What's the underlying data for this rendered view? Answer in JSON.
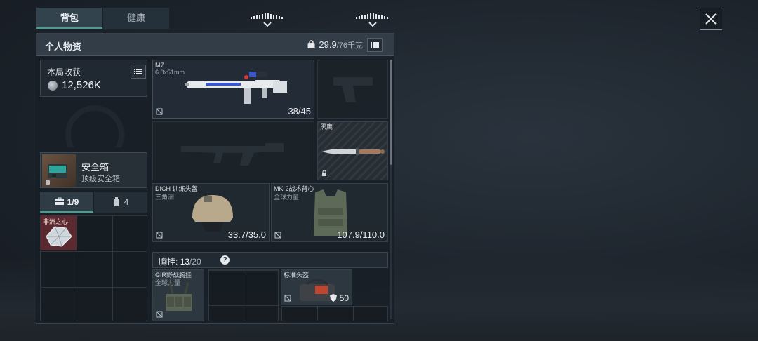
{
  "tabs": {
    "backpack": "背包",
    "health": "健康"
  },
  "panel": {
    "title": "个人物资",
    "weight_current": "29.9",
    "weight_capacity": "/76千克"
  },
  "earnings": {
    "label": "本局收获",
    "value": "12,526K"
  },
  "safe_box": {
    "name": "安全箱",
    "sub": "顶级安全箱"
  },
  "sub_tabs": {
    "box_count": "1/9",
    "item_count": "4"
  },
  "left_items": [
    {
      "label": "非洲之心"
    }
  ],
  "primary_weapon": {
    "name": "M7",
    "caliber": "6.8x51mm",
    "durability": "38/45"
  },
  "melee": {
    "name": "黑鹰"
  },
  "helmet": {
    "name": "DICH 训练头盔",
    "sub": "三角洲",
    "durability": "33.7/35.0"
  },
  "armor": {
    "name": "MK-2战术背心",
    "sub": "全球力量",
    "durability": "107.9/110.0"
  },
  "chest_rig": {
    "label": "胸挂:",
    "current": "13",
    "capacity": "/20",
    "help": "?"
  },
  "rig_item": {
    "name": "GIR野战胸挂",
    "sub": "全球力量"
  },
  "bag_item": {
    "name": "标准头盔",
    "count": "50"
  },
  "colors": {
    "accent": "#3aa58f",
    "rare_red": "#5a2a30"
  }
}
